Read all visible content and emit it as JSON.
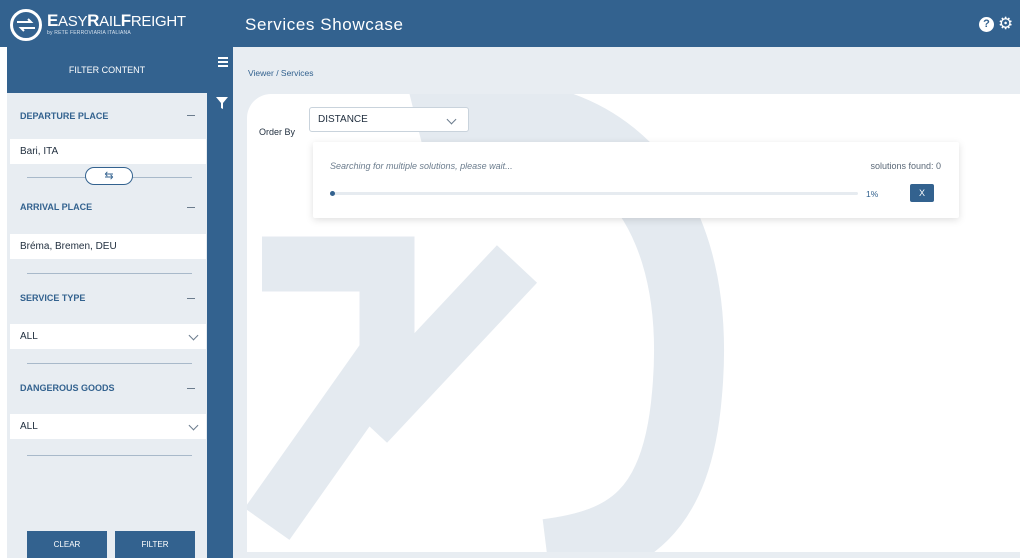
{
  "header": {
    "logo_text": {
      "e": "E",
      "asy": "ASY",
      "r": "R",
      "ail": "AIL",
      "f": "F",
      "reight": "REIGHT"
    },
    "logo_subtitle": "by RETE FERROVIARIA ITALIANA",
    "page_title": "Services Showcase",
    "help_glyph": "?",
    "settings_glyph": "⚙"
  },
  "sidebar": {
    "title": "FILTER CONTENT",
    "departure": {
      "label": "DEPARTURE PLACE",
      "value": "Bari, ITA"
    },
    "swap_glyph": "⇆",
    "arrival": {
      "label": "ARRIVAL PLACE",
      "value": "Bréma, Bremen, DEU"
    },
    "service_type": {
      "label": "SERVICE TYPE",
      "value": "ALL"
    },
    "dangerous_goods": {
      "label": "DANGEROUS GOODS",
      "value": "ALL"
    },
    "clear_label": "CLEAR",
    "filter_label": "FILTER"
  },
  "main": {
    "breadcrumb": "Viewer / Services",
    "order_by_label": "Order By",
    "order_by_value": "DISTANCE",
    "progress": {
      "message": "Searching for multiple solutions, please wait...",
      "solutions_found": "solutions found: 0",
      "percent_label": "1%",
      "percent": 1,
      "cancel_label": "X"
    }
  },
  "colors": {
    "primary": "#33628f",
    "panel": "#e8edf2",
    "link": "#33628f"
  },
  "icons": [
    "logo-icon",
    "help-icon",
    "gear-icon",
    "menu-icon",
    "funnel-icon",
    "swap-icon",
    "chevron-down-icon"
  ]
}
